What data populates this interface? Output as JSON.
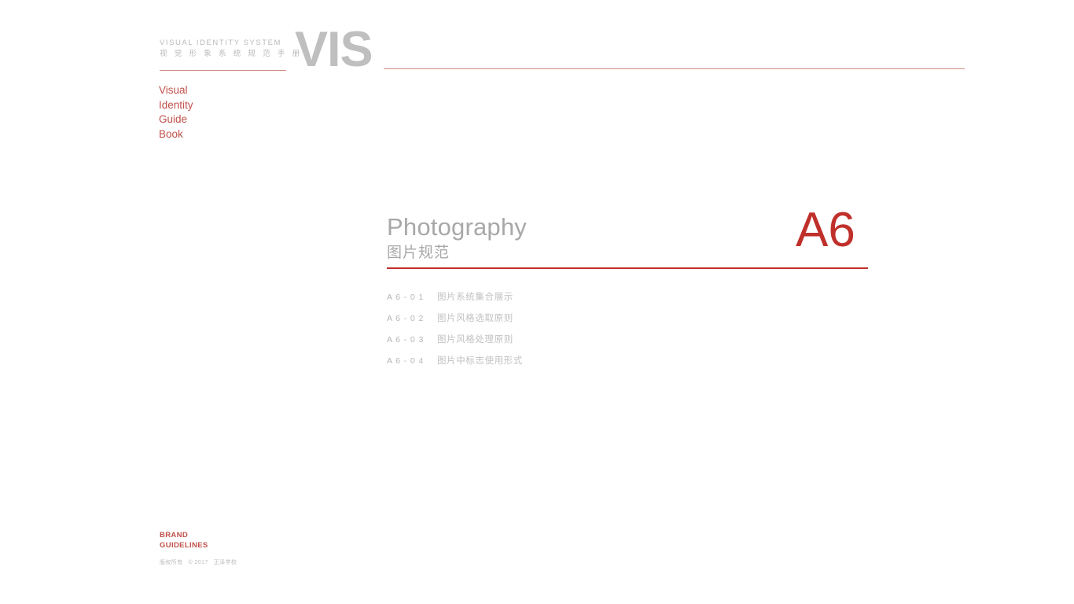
{
  "colors": {
    "accent_red": "#c1504a",
    "title_red": "#c0302b",
    "rule_pink": "#d08b85",
    "logo_grey": "#bfbfbf",
    "title_grey": "#a8a8a8",
    "muted_grey": "#c2c2c2"
  },
  "header": {
    "system_en": "VISUAL IDENTITY SYSTEM",
    "system_cn": "视 觉 形 象 系 统 规 范 手 册",
    "logotype": "VIS",
    "nav": {
      "line1": "Visual",
      "line2": "Identity",
      "line3": "Guide",
      "line4": "Book"
    }
  },
  "section": {
    "title_en": "Photography",
    "title_cn": "图片规范",
    "chapter_code": "A6"
  },
  "toc": {
    "items": [
      {
        "code": "A 6 - 0 1",
        "label": "图片系统集合展示"
      },
      {
        "code": "A 6 - 0 2",
        "label": "图片风格选取原则"
      },
      {
        "code": "A 6 - 0 3",
        "label": "图片风格处理原则"
      },
      {
        "code": "A 6 - 0 4",
        "label": "图片中标志使用形式"
      }
    ]
  },
  "footer": {
    "brand_line1": "BRAND",
    "brand_line2": "GUIDELINES",
    "copyright_cn": "版权所有",
    "copyright_mark": "© 2017",
    "copyright_owner": "正泽学校"
  }
}
